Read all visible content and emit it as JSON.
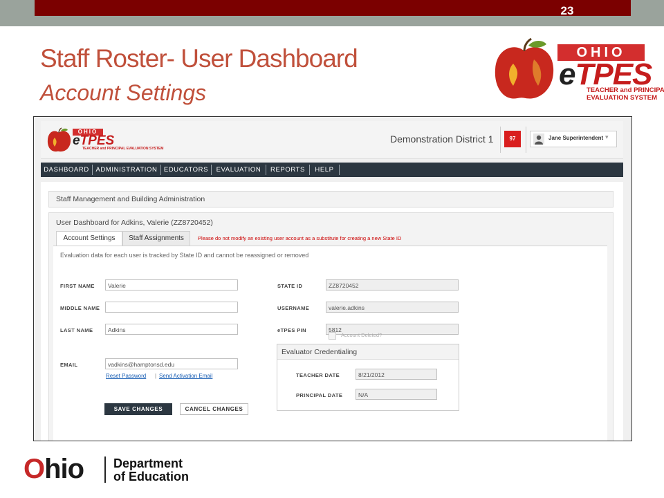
{
  "slide": {
    "number": "23",
    "title": "Staff Roster- User Dashboard",
    "subtitle": "Account Settings"
  },
  "header_logo": {
    "ohio": "OHIO",
    "etpes_e": "e",
    "etpes_tpes": "TPES",
    "tagline_1": "TEACHER and PRINCIPAL",
    "tagline_2": "EVALUATION SYSTEM"
  },
  "app": {
    "logo_ohio": "OHIO",
    "logo_e": "e",
    "logo_tpes": "TPES",
    "logo_tagline": "TEACHER and PRINCIPAL EVALUATION SYSTEM",
    "district": "Demonstration District 1",
    "notification_count": "97",
    "user_name": "Jane Superintendent",
    "user_caret": "▾",
    "nav": [
      "DASHBOARD",
      "ADMINISTRATION",
      "EDUCATORS",
      "EVALUATION",
      "REPORTS",
      "HELP"
    ],
    "staff_panel_title": "Staff Management and Building Administration",
    "dashboard_title": "User Dashboard for Adkins, Valerie (ZZ8720452)",
    "tabs": [
      "Account Settings",
      "Staff Assignments"
    ],
    "tab_warning": "Please do not modify an existing user account as a substitute for creating a new State ID",
    "note": "Evaluation data for each user is tracked by State ID and cannot be reassigned or removed",
    "form": {
      "first_name_label": "FIRST NAME",
      "first_name_value": "Valerie",
      "middle_name_label": "MIDDLE NAME",
      "middle_name_value": "",
      "last_name_label": "LAST NAME",
      "last_name_value": "Adkins",
      "email_label": "EMAIL",
      "email_value": "vadkins@hamptonsd.edu",
      "state_id_label": "STATE ID",
      "state_id_value": "ZZ8720452",
      "username_label": "USERNAME",
      "username_value": "valerie.adkins",
      "pin_label": "eTPES PIN",
      "pin_value": "5812",
      "account_deleted_label": "Account Deleted?",
      "account_deleted_checked": false
    },
    "links": {
      "reset_password": "Reset Password",
      "separator": "|",
      "send_activation": "Send Activation Email"
    },
    "buttons": {
      "save": "SAVE CHANGES",
      "cancel": "CANCEL CHANGES"
    },
    "credentialing": {
      "title": "Evaluator Credentialing",
      "teacher_date_label": "TEACHER DATE",
      "teacher_date_value": "8/21/2012",
      "principal_date_label": "PRINCIPAL DATE",
      "principal_date_value": "N/A"
    }
  },
  "footer": {
    "ohio_o": "O",
    "ohio_rest": "hio",
    "dept_line1": "Department",
    "dept_line2": "of Education"
  },
  "colors": {
    "title_color": "#c0503b",
    "top_bar_red": "#7b0000",
    "top_bar_gray": "#9aa39c",
    "nav_bg": "#2c3741",
    "notification_red": "#d91e1e",
    "warning_red": "#cc0000",
    "link_blue": "#1a5fb4"
  }
}
